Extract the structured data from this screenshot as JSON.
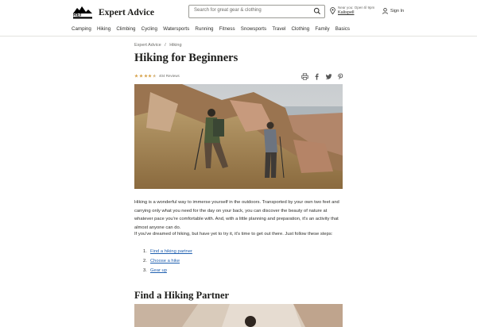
{
  "header": {
    "brand": "Expert Advice",
    "search_placeholder": "Search for great gear & clothing",
    "store_status": "Near you: Open til 9pm",
    "store_name": "Kalispell",
    "signin_label": "Sign In"
  },
  "nav": [
    "Camping",
    "Hiking",
    "Climbing",
    "Cycling",
    "Watersports",
    "Running",
    "Fitness",
    "Snowsports",
    "Travel",
    "Clothing",
    "Family",
    "Basics"
  ],
  "breadcrumb": {
    "item0": "Expert Advice",
    "sep": "/",
    "item1": "Hiking"
  },
  "article": {
    "title": "Hiking for Beginners",
    "rating": 4.5,
    "reviews": "404 Reviews",
    "p1": "Hiking is a wonderful way to immerse yourself in the outdoors. Transported by your own two feet and carrying only what you need for the day on your back, you can discover the beauty of nature at whatever pace you're comfortable with. And, with a little planning and preparation, it's an activity that almost anyone can do.",
    "p2": "If you've dreamed of hiking, but have yet to try it, it's time to get out there. Just follow these steps:",
    "steps": [
      {
        "num": "1.",
        "label": "Find a hiking partner"
      },
      {
        "num": "2.",
        "label": "Choose a hike"
      },
      {
        "num": "3.",
        "label": "Gear up"
      }
    ],
    "section_title": "Find a Hiking Partner"
  },
  "colors": {
    "link": "#2060b0",
    "star": "#d6a24a",
    "text": "#2e2e2b"
  },
  "icons": [
    "rei-logo",
    "search-icon",
    "location-pin-icon",
    "user-icon",
    "print-icon",
    "facebook-icon",
    "twitter-icon",
    "pinterest-icon"
  ]
}
